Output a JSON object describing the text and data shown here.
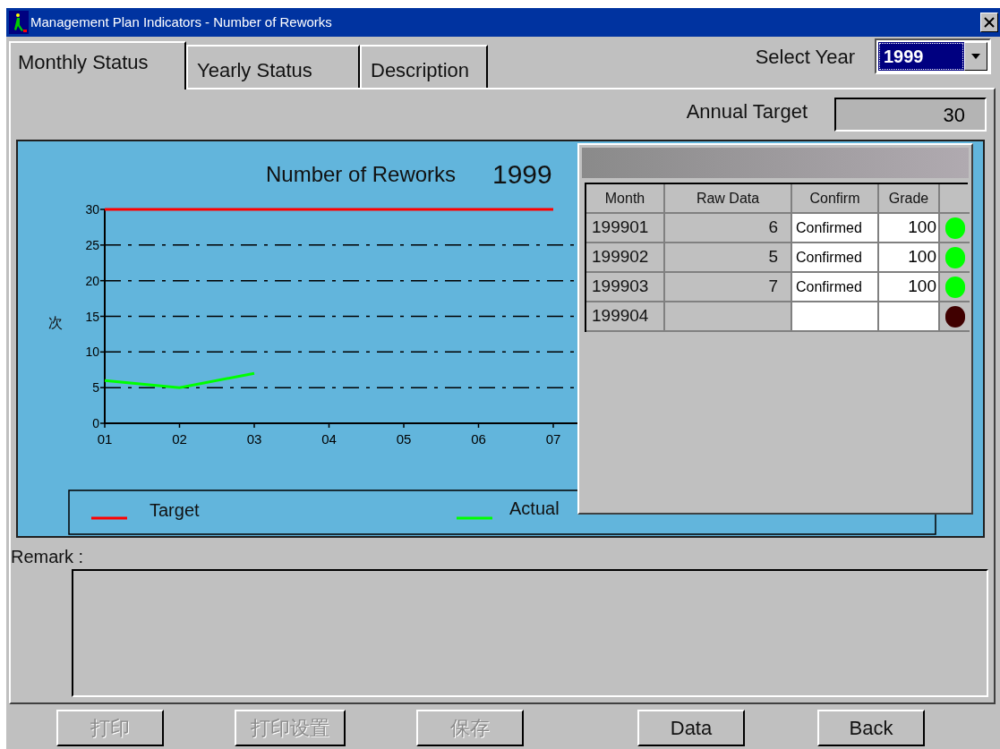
{
  "window": {
    "title": "Management Plan Indicators -  Number of Reworks"
  },
  "tabs": [
    {
      "label": "Monthly Status",
      "selected": true
    },
    {
      "label": "Yearly Status",
      "selected": false
    },
    {
      "label": "Description",
      "selected": false
    }
  ],
  "select_year": {
    "label": "Select Year",
    "value": "1999"
  },
  "annual_target": {
    "label": "Annual Target",
    "value": "30"
  },
  "chart": {
    "year": "1999",
    "chart_data": {
      "type": "line",
      "title": "Number of Reworks",
      "ylabel": "次",
      "categories": [
        "01",
        "02",
        "03",
        "04",
        "05",
        "06",
        "07"
      ],
      "series": [
        {
          "name": "Target",
          "color": "#ff0000",
          "values": [
            30,
            30,
            30,
            30,
            30,
            30,
            30
          ]
        },
        {
          "name": "Actual",
          "color": "#00ff00",
          "values": [
            6,
            5,
            7,
            null,
            null,
            null,
            null
          ]
        }
      ],
      "ylim": [
        0,
        30
      ],
      "yticks": [
        0,
        5,
        10,
        15,
        20,
        25,
        30
      ],
      "grid": true,
      "legend": true
    }
  },
  "data_table": {
    "columns": [
      "Month",
      "Raw Data",
      "Confirm",
      "Grade"
    ],
    "rows": [
      {
        "month": "199901",
        "raw_data": "6",
        "confirm": "Confirmed",
        "grade": "100",
        "color": "#00ff00"
      },
      {
        "month": "199902",
        "raw_data": "5",
        "confirm": "Confirmed",
        "grade": "100",
        "color": "#00ff00"
      },
      {
        "month": "199903",
        "raw_data": "7",
        "confirm": "Confirmed",
        "grade": "100",
        "color": "#00ff00"
      },
      {
        "month": "199904",
        "color": "#400000"
      }
    ]
  },
  "remark": {
    "label": "Remark :"
  },
  "buttons": [
    {
      "label": "打印",
      "disabled": true
    },
    {
      "label": "打印设置",
      "disabled": true
    },
    {
      "label": "保存",
      "disabled": true
    },
    {
      "label": "Data",
      "disabled": false
    },
    {
      "label": "Back",
      "disabled": false
    }
  ]
}
